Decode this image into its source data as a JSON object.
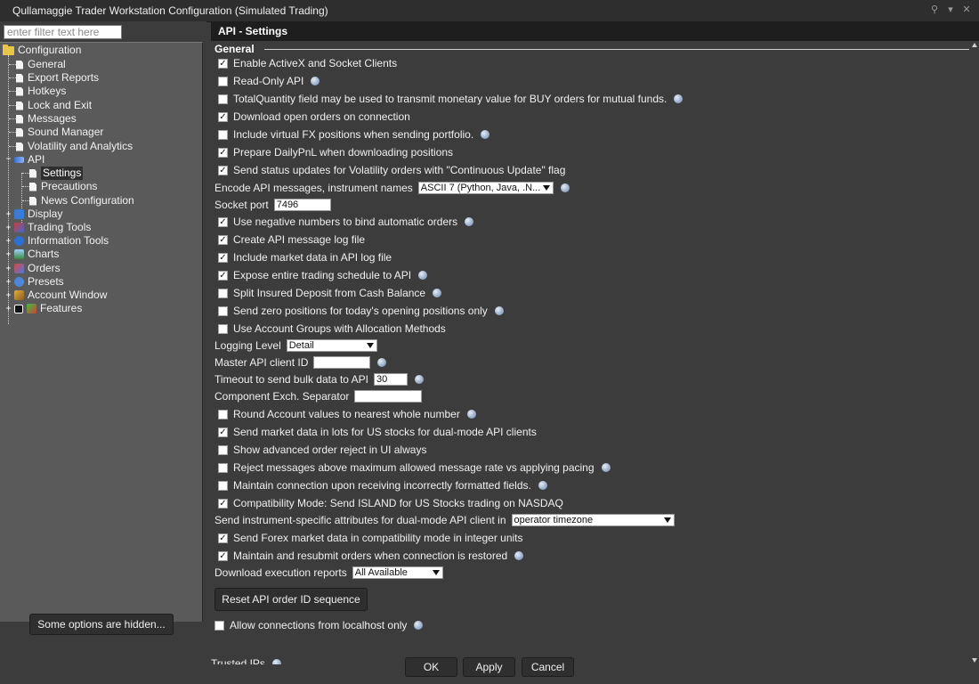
{
  "window": {
    "title": "Qullamaggie Trader Workstation Configuration (Simulated Trading)"
  },
  "filter": {
    "placeholder": "enter filter text here"
  },
  "tree": {
    "root": "Configuration",
    "items": [
      "General",
      "Export Reports",
      "Hotkeys",
      "Lock and Exit",
      "Messages",
      "Sound Manager",
      "Volatility and Analytics"
    ],
    "api": "API",
    "api_children": [
      "Settings",
      "Precautions",
      "News Configuration"
    ],
    "categories": [
      "Display",
      "Trading Tools",
      "Information Tools",
      "Charts",
      "Orders",
      "Presets",
      "Account Window",
      "Features"
    ]
  },
  "hidden_button": "Some options are hidden...",
  "panel": {
    "title": "API - Settings",
    "section": "General"
  },
  "settings": {
    "enable_activex": {
      "label": "Enable ActiveX and Socket Clients",
      "checked": true
    },
    "read_only": {
      "label": "Read-Only API",
      "checked": false
    },
    "total_quantity": {
      "label": "TotalQuantity field may be used to transmit monetary value for BUY orders for mutual funds.",
      "checked": false
    },
    "download_open_orders": {
      "label": "Download open orders on connection",
      "checked": true
    },
    "virtual_fx": {
      "label": "Include virtual FX positions when sending portfolio.",
      "checked": false
    },
    "daily_pnl": {
      "label": "Prepare DailyPnL when downloading positions",
      "checked": true
    },
    "status_updates": {
      "label": "Send status updates for Volatility orders with \"Continuous Update\" flag",
      "checked": true
    },
    "encode_label": "Encode API messages, instrument names",
    "encode_value": "ASCII 7 (Python, Java, .N...",
    "socket_label": "Socket port",
    "socket_value": "7496",
    "negative_numbers": {
      "label": "Use negative numbers to bind automatic orders",
      "checked": true
    },
    "create_log": {
      "label": "Create API message log file",
      "checked": true
    },
    "include_market_data": {
      "label": "Include market data in API log file",
      "checked": true
    },
    "expose_schedule": {
      "label": "Expose entire trading schedule to API",
      "checked": true
    },
    "split_insured": {
      "label": "Split Insured Deposit from Cash Balance",
      "checked": false
    },
    "send_zero_positions": {
      "label": "Send zero positions for today's opening positions only",
      "checked": false
    },
    "account_groups": {
      "label": "Use Account Groups with Allocation Methods",
      "checked": false
    },
    "logging_label": "Logging Level",
    "logging_value": "Detail",
    "master_id_label": "Master API client ID",
    "master_id_value": "",
    "timeout_label": "Timeout to send bulk data to API",
    "timeout_value": "30",
    "component_label": "Component Exch. Separator",
    "component_value": "",
    "round_account": {
      "label": "Round Account values to nearest whole number",
      "checked": false
    },
    "market_data_lots": {
      "label": "Send market data in lots for US stocks for dual-mode API clients",
      "checked": true
    },
    "advanced_reject": {
      "label": "Show advanced order reject in UI always",
      "checked": false
    },
    "reject_messages": {
      "label": "Reject messages above maximum allowed message rate vs applying pacing",
      "checked": false
    },
    "maintain_connection": {
      "label": "Maintain connection upon receiving incorrectly formatted fields.",
      "checked": false
    },
    "compatibility_mode": {
      "label": "Compatibility Mode: Send ISLAND for US Stocks trading on NASDAQ",
      "checked": true
    },
    "instrument_attr_label": "Send instrument-specific attributes for dual-mode API client in",
    "instrument_attr_value": "operator timezone",
    "forex_integer": {
      "label": "Send Forex market data in compatibility mode in integer units",
      "checked": true
    },
    "resubmit_orders": {
      "label": "Maintain and resubmit orders when connection is restored",
      "checked": true
    },
    "download_exec_label": "Download execution reports",
    "download_exec_value": "All Available",
    "reset_button": "Reset API order ID sequence",
    "localhost_only": {
      "label": "Allow connections from localhost only",
      "checked": false
    },
    "trusted_ips": "Trusted IPs"
  },
  "footer": {
    "ok": "OK",
    "apply": "Apply",
    "cancel": "Cancel"
  }
}
